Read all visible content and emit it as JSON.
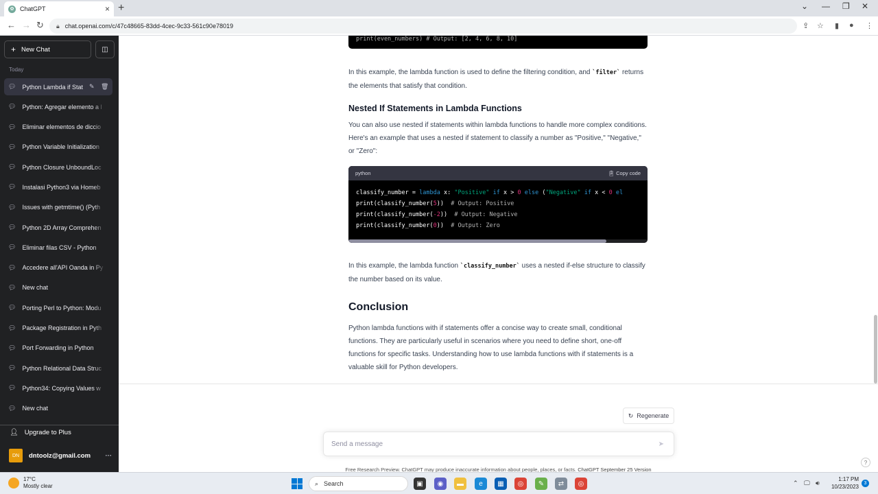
{
  "browser": {
    "tab_title": "ChatGPT",
    "url": "chat.openai.com/c/47c48665-83dd-4cec-9c33-561c90e78019"
  },
  "sidebar": {
    "new_chat": "New Chat",
    "section": "Today",
    "items": [
      {
        "label": "Python Lambda if Stat"
      },
      {
        "label": "Python: Agregar elemento a l"
      },
      {
        "label": "Eliminar elementos de diccio"
      },
      {
        "label": "Python Variable Initialization"
      },
      {
        "label": "Python Closure UnboundLoc"
      },
      {
        "label": "Instalasi Python3 via Homeb"
      },
      {
        "label": "Issues with getmtime() (Pyth"
      },
      {
        "label": "Python 2D Array Comprehen"
      },
      {
        "label": "Eliminar filas CSV - Python"
      },
      {
        "label": "Accedere all'API Oanda in Py"
      },
      {
        "label": "New chat"
      },
      {
        "label": "Porting Perl to Python: Modu"
      },
      {
        "label": "Package Registration in Pyth"
      },
      {
        "label": "Port Forwarding in Python"
      },
      {
        "label": "Python Relational Data Struc"
      },
      {
        "label": "Python34: Copying Values w"
      },
      {
        "label": "New chat"
      }
    ],
    "upgrade": "Upgrade to Plus",
    "account_initials": "DN",
    "account_email": "dntoolz@gmail.com"
  },
  "content": {
    "code_top_line": "print(even_numbers)  # Output: [2, 4, 6, 8, 10]",
    "p1_a": "In this example, the lambda function is used to define the filtering condition, and ",
    "p1_code": "`filter`",
    "p1_b": " returns the elements that satisfy that condition.",
    "heading_nested": "Nested If Statements in Lambda Functions",
    "p2": "You can also use nested if statements within lambda functions to handle more complex conditions. Here's an example that uses a nested if statement to classify a number as \"Positive,\" \"Negative,\" or \"Zero\":",
    "code_lang": "python",
    "copy_code": "Copy code",
    "p3_a": "In this example, the lambda function ",
    "p3_code": "`classify_number`",
    "p3_b": " uses a nested if-else structure to classify the number based on its value.",
    "heading_conclusion": "Conclusion",
    "p4": "Python lambda functions with if statements offer a concise way to create small, conditional functions. They are particularly useful in scenarios where you need to define short, one-off functions for specific tasks. Understanding how to use lambda functions with if statements is a valuable skill for Python developers."
  },
  "composer": {
    "regenerate": "Regenerate",
    "placeholder": "Send a message",
    "footer_text": "Free Research Preview. ChatGPT may produce inaccurate information about people, places, or facts. ",
    "footer_link": "ChatGPT September 25 Version"
  },
  "taskbar": {
    "temp": "17°C",
    "weather": "Mostly clear",
    "search": "Search",
    "time": "1:17 PM",
    "date": "10/23/2023",
    "notifications": "3"
  }
}
